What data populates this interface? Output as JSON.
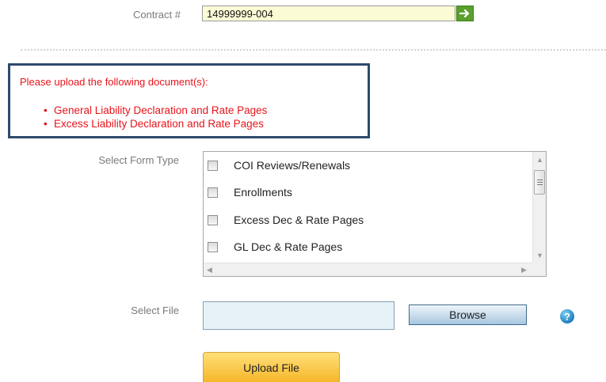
{
  "contract": {
    "label": "Contract #",
    "value": "14999999-004"
  },
  "notice": {
    "title": "Please upload the following document(s):",
    "items": [
      "General Liability Declaration and Rate Pages",
      "Excess Liability Declaration and Rate Pages"
    ],
    "color": "#e8141b",
    "border_color": "#2e4a6e"
  },
  "form_type": {
    "label": "Select Form Type",
    "options": [
      {
        "label": "COI Reviews/Renewals",
        "checked": false
      },
      {
        "label": "Enrollments",
        "checked": false
      },
      {
        "label": "Excess Dec & Rate Pages",
        "checked": false
      },
      {
        "label": "GL Dec & Rate Pages",
        "checked": false
      }
    ]
  },
  "file": {
    "label": "Select File",
    "value": "",
    "browse_label": "Browse",
    "help_symbol": "?"
  },
  "upload": {
    "label": "Upload File"
  },
  "colors": {
    "go_button": "#5aa02c",
    "upload_button": "#f6b62a",
    "contract_field_bg": "#fbfcd6"
  }
}
